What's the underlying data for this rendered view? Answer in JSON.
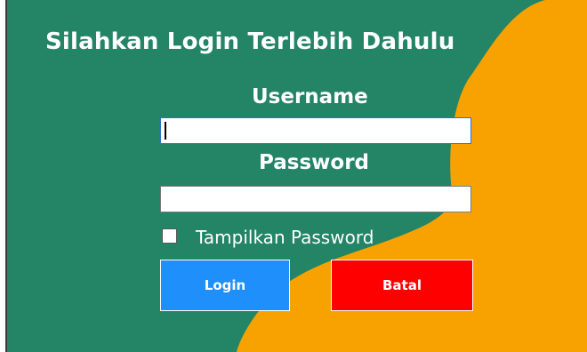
{
  "form": {
    "title": "Silahkan Login Terlebih Dahulu",
    "username_label": "Username",
    "username_value": "",
    "password_label": "Password",
    "password_value": "",
    "show_password_label": "Tampilkan Password",
    "show_password_checked": false,
    "login_label": "Login",
    "cancel_label": "Batal"
  },
  "colors": {
    "background": "#238466",
    "accent_wave": "#f7a200",
    "login_button": "#1f8ffb",
    "cancel_button": "#fe0000",
    "text": "#ffffff"
  }
}
